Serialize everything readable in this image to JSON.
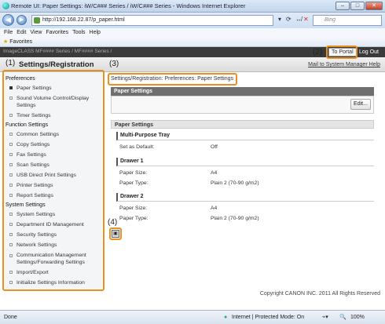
{
  "browser": {
    "window_title": "Remote UI: Paper Settings: iW/C###  Series / iW/C###  Series - Windows Internet Explorer",
    "url": "http://192.168.22.87/p_paper.html",
    "search_placeholder": "Bing",
    "menu": [
      "File",
      "Edit",
      "View",
      "Favorites",
      "Tools",
      "Help"
    ],
    "favorites_label": "Favorites",
    "status_left": "Done",
    "status_zone": "Internet | Protected Mode: On",
    "zoom": "100%"
  },
  "app": {
    "top_title": "ImageCLASS    MF####  Series / MF####  Series /",
    "to_portal": "To Portal",
    "logout": "Log Out",
    "header_title": "Settings/Registration",
    "header_links": "Mail to System Manager  Help",
    "breadcrumb": "Settings/Registration: Preferences: Paper Settings",
    "section1_title": "Paper Settings",
    "edit_label": "Edit...",
    "section2_title": "Paper Settings",
    "copyright": "Copyright CANON INC. 2011 All Rights Reserved"
  },
  "sidebar": {
    "preferences": "Preferences",
    "function_settings": "Function Settings",
    "system_settings": "System Settings",
    "pref_items": [
      "Paper Settings",
      "Sound Volume Control/Display Settings",
      "Timer Settings"
    ],
    "func_items": [
      "Common Settings",
      "Copy Settings",
      "Fax Settings",
      "Scan Settings",
      "USB Direct Print Settings",
      "Printer Settings",
      "Report Settings"
    ],
    "sys_items": [
      "System Settings",
      "Department ID Management",
      "Security Settings",
      "Network Settings",
      "Communication Management Settings/Forwarding Settings",
      "Import/Export",
      "Initialize Settings Information"
    ]
  },
  "paper": {
    "mp_tray": "Multi-Purpose Tray",
    "set_default_label": "Set as Default:",
    "set_default_value": "Off",
    "drawer1": "Drawer 1",
    "drawer2": "Drawer 2",
    "paper_size_label": "Paper Size:",
    "paper_type_label": "Paper Type:",
    "d1_size": "A4",
    "d1_type": "Plain 2 (70-90 g/m2)",
    "d2_size": "A4",
    "d2_type": "Plain 2 (70-90 g/m2)"
  },
  "callouts": {
    "c1": "(1)",
    "c2": "(2)",
    "c3": "(3)",
    "c4": "(4)"
  },
  "colors": {
    "callout": "#e89020",
    "header_dark": "#3a3a3a",
    "section_bar": "#6f6f6f"
  }
}
